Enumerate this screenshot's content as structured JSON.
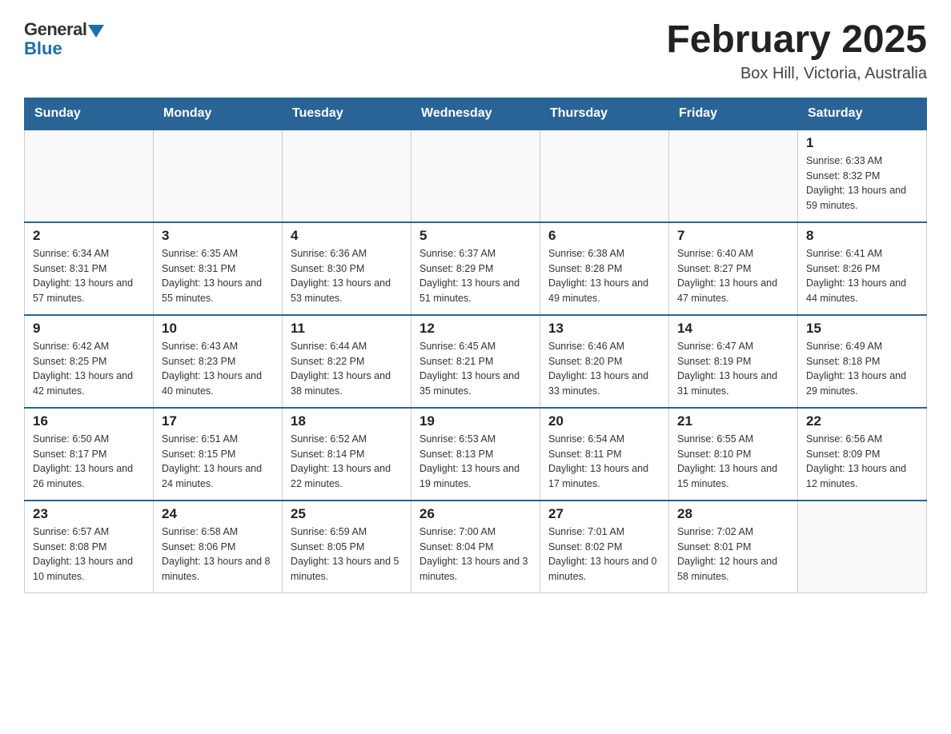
{
  "logo": {
    "general": "General",
    "blue": "Blue"
  },
  "title": "February 2025",
  "location": "Box Hill, Victoria, Australia",
  "days_of_week": [
    "Sunday",
    "Monday",
    "Tuesday",
    "Wednesday",
    "Thursday",
    "Friday",
    "Saturday"
  ],
  "weeks": [
    [
      {
        "day": "",
        "info": ""
      },
      {
        "day": "",
        "info": ""
      },
      {
        "day": "",
        "info": ""
      },
      {
        "day": "",
        "info": ""
      },
      {
        "day": "",
        "info": ""
      },
      {
        "day": "",
        "info": ""
      },
      {
        "day": "1",
        "info": "Sunrise: 6:33 AM\nSunset: 8:32 PM\nDaylight: 13 hours and 59 minutes."
      }
    ],
    [
      {
        "day": "2",
        "info": "Sunrise: 6:34 AM\nSunset: 8:31 PM\nDaylight: 13 hours and 57 minutes."
      },
      {
        "day": "3",
        "info": "Sunrise: 6:35 AM\nSunset: 8:31 PM\nDaylight: 13 hours and 55 minutes."
      },
      {
        "day": "4",
        "info": "Sunrise: 6:36 AM\nSunset: 8:30 PM\nDaylight: 13 hours and 53 minutes."
      },
      {
        "day": "5",
        "info": "Sunrise: 6:37 AM\nSunset: 8:29 PM\nDaylight: 13 hours and 51 minutes."
      },
      {
        "day": "6",
        "info": "Sunrise: 6:38 AM\nSunset: 8:28 PM\nDaylight: 13 hours and 49 minutes."
      },
      {
        "day": "7",
        "info": "Sunrise: 6:40 AM\nSunset: 8:27 PM\nDaylight: 13 hours and 47 minutes."
      },
      {
        "day": "8",
        "info": "Sunrise: 6:41 AM\nSunset: 8:26 PM\nDaylight: 13 hours and 44 minutes."
      }
    ],
    [
      {
        "day": "9",
        "info": "Sunrise: 6:42 AM\nSunset: 8:25 PM\nDaylight: 13 hours and 42 minutes."
      },
      {
        "day": "10",
        "info": "Sunrise: 6:43 AM\nSunset: 8:23 PM\nDaylight: 13 hours and 40 minutes."
      },
      {
        "day": "11",
        "info": "Sunrise: 6:44 AM\nSunset: 8:22 PM\nDaylight: 13 hours and 38 minutes."
      },
      {
        "day": "12",
        "info": "Sunrise: 6:45 AM\nSunset: 8:21 PM\nDaylight: 13 hours and 35 minutes."
      },
      {
        "day": "13",
        "info": "Sunrise: 6:46 AM\nSunset: 8:20 PM\nDaylight: 13 hours and 33 minutes."
      },
      {
        "day": "14",
        "info": "Sunrise: 6:47 AM\nSunset: 8:19 PM\nDaylight: 13 hours and 31 minutes."
      },
      {
        "day": "15",
        "info": "Sunrise: 6:49 AM\nSunset: 8:18 PM\nDaylight: 13 hours and 29 minutes."
      }
    ],
    [
      {
        "day": "16",
        "info": "Sunrise: 6:50 AM\nSunset: 8:17 PM\nDaylight: 13 hours and 26 minutes."
      },
      {
        "day": "17",
        "info": "Sunrise: 6:51 AM\nSunset: 8:15 PM\nDaylight: 13 hours and 24 minutes."
      },
      {
        "day": "18",
        "info": "Sunrise: 6:52 AM\nSunset: 8:14 PM\nDaylight: 13 hours and 22 minutes."
      },
      {
        "day": "19",
        "info": "Sunrise: 6:53 AM\nSunset: 8:13 PM\nDaylight: 13 hours and 19 minutes."
      },
      {
        "day": "20",
        "info": "Sunrise: 6:54 AM\nSunset: 8:11 PM\nDaylight: 13 hours and 17 minutes."
      },
      {
        "day": "21",
        "info": "Sunrise: 6:55 AM\nSunset: 8:10 PM\nDaylight: 13 hours and 15 minutes."
      },
      {
        "day": "22",
        "info": "Sunrise: 6:56 AM\nSunset: 8:09 PM\nDaylight: 13 hours and 12 minutes."
      }
    ],
    [
      {
        "day": "23",
        "info": "Sunrise: 6:57 AM\nSunset: 8:08 PM\nDaylight: 13 hours and 10 minutes."
      },
      {
        "day": "24",
        "info": "Sunrise: 6:58 AM\nSunset: 8:06 PM\nDaylight: 13 hours and 8 minutes."
      },
      {
        "day": "25",
        "info": "Sunrise: 6:59 AM\nSunset: 8:05 PM\nDaylight: 13 hours and 5 minutes."
      },
      {
        "day": "26",
        "info": "Sunrise: 7:00 AM\nSunset: 8:04 PM\nDaylight: 13 hours and 3 minutes."
      },
      {
        "day": "27",
        "info": "Sunrise: 7:01 AM\nSunset: 8:02 PM\nDaylight: 13 hours and 0 minutes."
      },
      {
        "day": "28",
        "info": "Sunrise: 7:02 AM\nSunset: 8:01 PM\nDaylight: 12 hours and 58 minutes."
      },
      {
        "day": "",
        "info": ""
      }
    ]
  ]
}
